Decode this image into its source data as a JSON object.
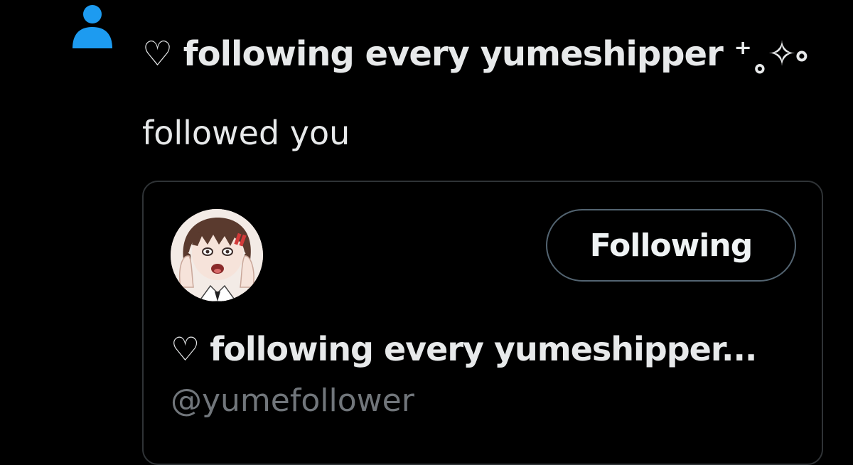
{
  "notification": {
    "icon": "person-icon",
    "account_name": "♡ following every yumeshipper ⁺˳✧༚",
    "action_text": "followed you"
  },
  "card": {
    "avatar_icon": "anime-avatar",
    "follow_button_label": "Following",
    "display_name": "♡ following every yumeshipper...",
    "handle": "@yumefollower"
  },
  "colors": {
    "background": "#000000",
    "accent": "#1d9bf0",
    "text_primary": "#e7e9ea",
    "text_secondary": "#71767b",
    "border": "#2f3336",
    "button_border": "#536471"
  }
}
